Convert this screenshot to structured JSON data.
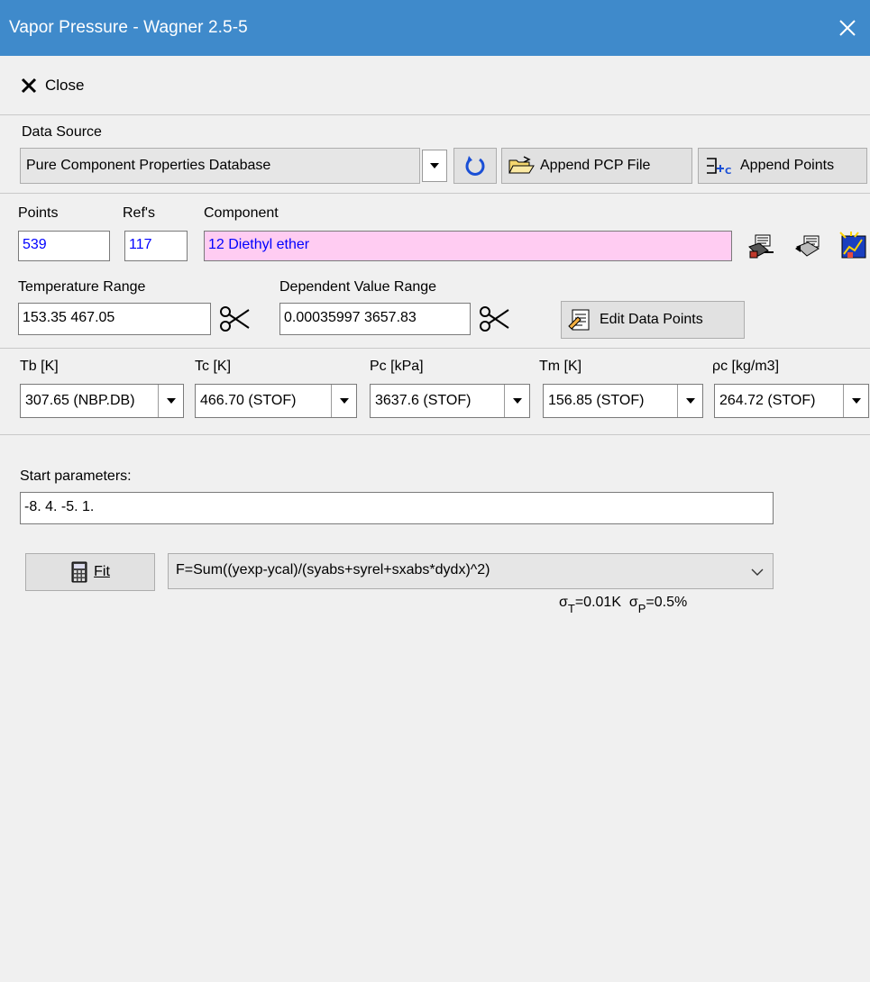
{
  "window": {
    "title": "Vapor Pressure - Wagner 2.5-5"
  },
  "toolbar": {
    "close_label": "Close"
  },
  "data_source": {
    "label": "Data Source",
    "selected": "Pure Component Properties Database",
    "append_pcp_label": "Append PCP File",
    "append_points_label": "Append Points"
  },
  "dataset": {
    "points_label": "Points",
    "points_value": "539",
    "refs_label": "Ref's",
    "refs_value": "117",
    "component_label": "Component",
    "component_value": "12 Diethyl ether"
  },
  "ranges": {
    "temperature_label": "Temperature Range",
    "temperature_value": "153.35 467.05",
    "dependent_label": "Dependent Value Range",
    "dependent_value": "0.00035997 3657.83",
    "edit_points_label": "Edit Data Points"
  },
  "properties": [
    {
      "label": "Tb [K]",
      "value": "307.65 (NBP.DB)"
    },
    {
      "label": "Tc [K]",
      "value": "466.70 (STOF)"
    },
    {
      "label": "Pc [kPa]",
      "value": "3637.6 (STOF)"
    },
    {
      "label": "Tm [K]",
      "value": "156.85 (STOF)"
    },
    {
      "label": "ρc [kg/m3]",
      "value": "264.72 (STOF)"
    }
  ],
  "fit": {
    "start_label": "Start parameters:",
    "start_value": "-8. 4. -5. 1.",
    "fit_button_label": "Fit",
    "objective_selected": "F=Sum((yexp-ycal)/(syabs+syrel+sxabs*dydx)^2)",
    "sigma": {
      "sT_prefix": "σ",
      "sT_sub": "T",
      "sT_val": "=0.01K",
      "sP_prefix": "σ",
      "sP_sub": "P",
      "sP_val": "=0.5%"
    }
  }
}
